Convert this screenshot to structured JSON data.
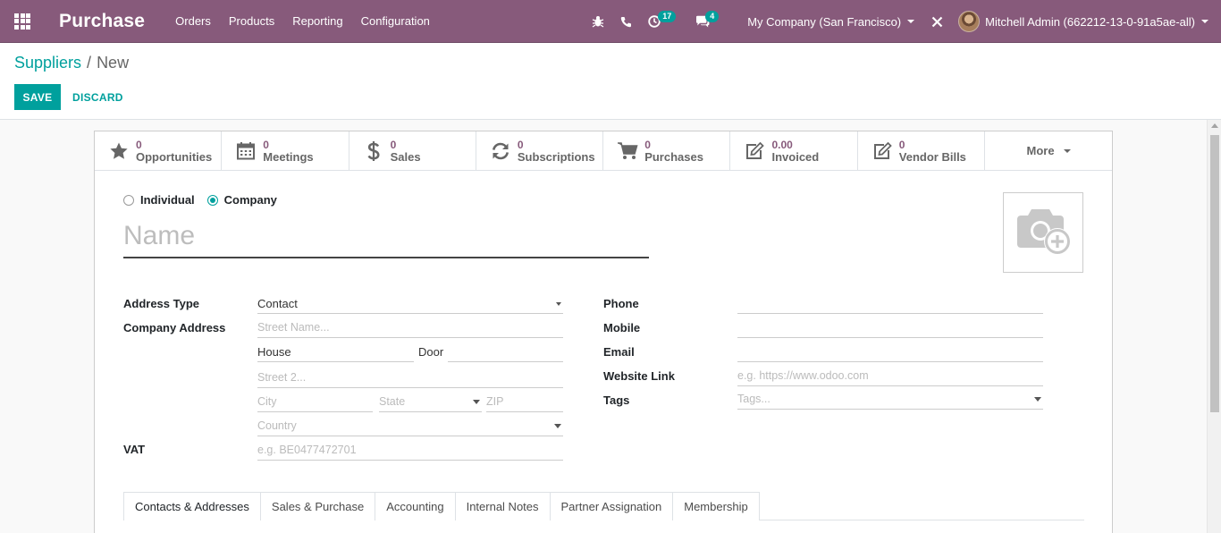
{
  "navbar": {
    "brand": "Purchase",
    "menu": [
      "Orders",
      "Products",
      "Reporting",
      "Configuration"
    ],
    "activity_count": "17",
    "message_count": "4",
    "company": "My Company (San Francisco)",
    "user": "Mitchell Admin (662212-13-0-91a5ae-all)"
  },
  "breadcrumb": {
    "parent": "Suppliers",
    "separator": "/",
    "current": "New"
  },
  "actions": {
    "save": "SAVE",
    "discard": "DISCARD"
  },
  "smart_buttons": [
    {
      "value": "0",
      "label": "Opportunities",
      "icon": "star-icon"
    },
    {
      "value": "0",
      "label": "Meetings",
      "icon": "calendar-icon"
    },
    {
      "value": "0",
      "label": "Sales",
      "icon": "dollar-icon"
    },
    {
      "value": "0",
      "label": "Subscriptions",
      "icon": "refresh-icon"
    },
    {
      "value": "0",
      "label": "Purchases",
      "icon": "cart-icon"
    },
    {
      "value": "0.00",
      "label": "Invoiced",
      "icon": "edit-icon"
    },
    {
      "value": "0",
      "label": "Vendor Bills",
      "icon": "edit-icon"
    }
  ],
  "more_label": "More",
  "company_type": {
    "individual": "Individual",
    "company": "Company",
    "selected": "company"
  },
  "name_placeholder": "Name",
  "left_fields": {
    "address_type_label": "Address Type",
    "address_type_value": "Contact",
    "company_address_label": "Company Address",
    "street_placeholder": "Street Name...",
    "house_label": "House",
    "door_label": "Door",
    "street2_placeholder": "Street 2...",
    "city_placeholder": "City",
    "state_placeholder": "State",
    "zip_placeholder": "ZIP",
    "country_placeholder": "Country",
    "vat_label": "VAT",
    "vat_placeholder": "e.g. BE0477472701"
  },
  "right_fields": {
    "phone_label": "Phone",
    "mobile_label": "Mobile",
    "email_label": "Email",
    "website_label": "Website Link",
    "website_placeholder": "e.g. https://www.odoo.com",
    "tags_label": "Tags",
    "tags_placeholder": "Tags..."
  },
  "tabs": [
    "Contacts & Addresses",
    "Sales & Purchase",
    "Accounting",
    "Internal Notes",
    "Partner Assignation",
    "Membership"
  ],
  "colors": {
    "navbar": "#875a7b",
    "accent": "#00a09d"
  }
}
